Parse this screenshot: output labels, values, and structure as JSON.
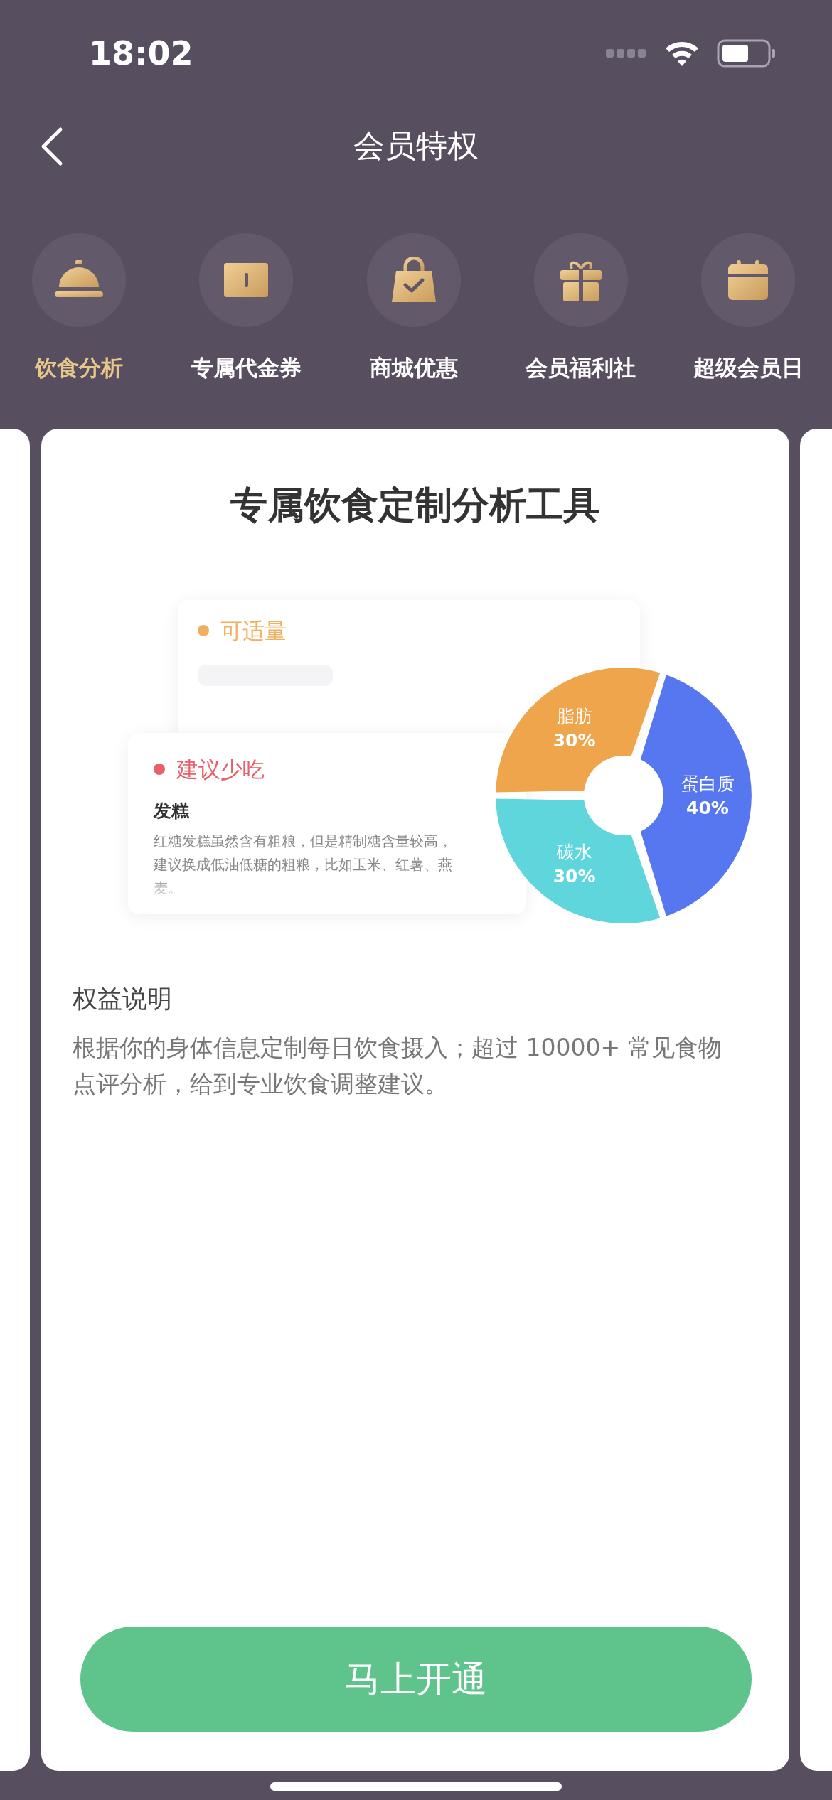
{
  "status_bar": {
    "time": "18:02"
  },
  "header": {
    "title": "会员特权"
  },
  "tabs": [
    {
      "label": "饮食分析",
      "selected": true,
      "kind": "bell"
    },
    {
      "label": "专属代金券",
      "selected": false,
      "kind": "ticket"
    },
    {
      "label": "商城优惠",
      "selected": false,
      "kind": "bag"
    },
    {
      "label": "会员福利社",
      "selected": false,
      "kind": "gift"
    },
    {
      "label": "超级会员日",
      "selected": false,
      "kind": "calendar"
    }
  ],
  "card": {
    "title": "专属饮食定制分析工具",
    "illustration": {
      "back_note": {
        "label": "可适量"
      },
      "front_note": {
        "label": "建议少吃",
        "food": "发糕",
        "text": "红糖发糕虽然含有粗粮，但是精制糖含量较高，建议换成低油低糖的粗粮，比如玉米、红薯、燕麦。"
      },
      "chart_data": {
        "type": "donut",
        "categories": [
          "脂肪",
          "蛋白质",
          "碳水"
        ],
        "values": [
          30,
          40,
          30
        ],
        "colors": [
          "#efa54c",
          "#5677f0",
          "#5fd6dc"
        ],
        "value_labels": [
          "30%",
          "40%",
          "30%"
        ]
      }
    },
    "benefit": {
      "heading": "权益说明",
      "text": "根据你的身体信息定制每日饮食摄入；超过 10000+ 常见食物点评分析，给到专业饮食调整建议。"
    },
    "button": {
      "label": "马上开通"
    }
  }
}
